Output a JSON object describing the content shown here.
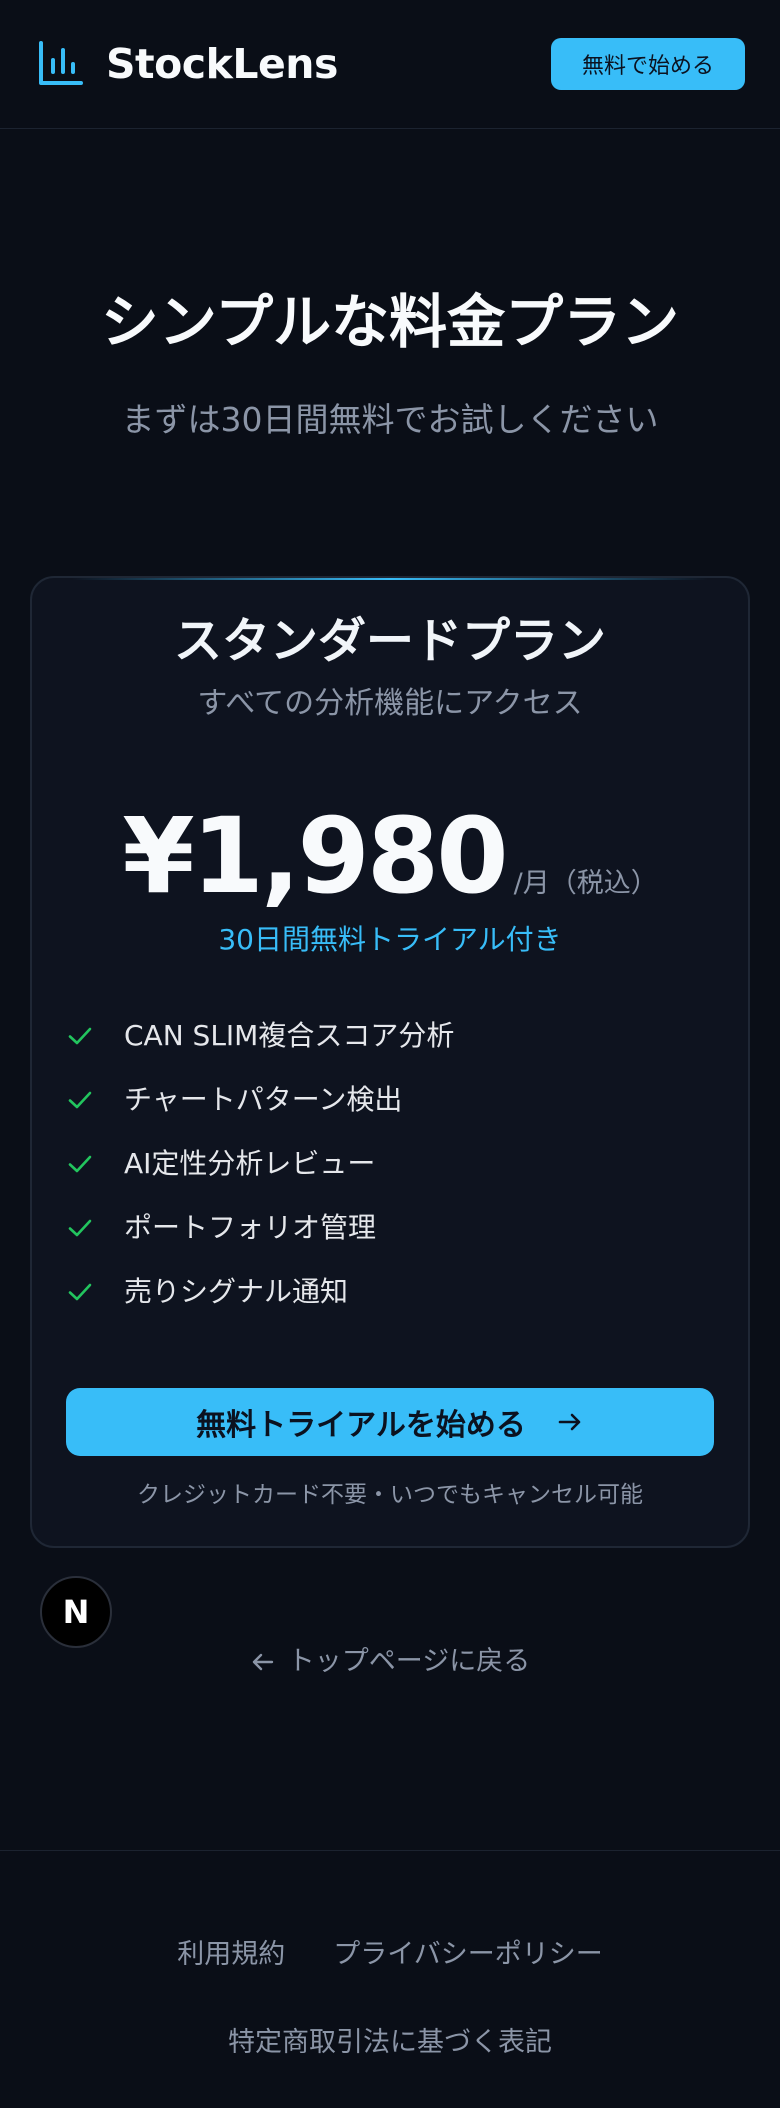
{
  "header": {
    "brand": "StockLens",
    "cta_label": "無料で始める"
  },
  "hero": {
    "title": "シンプルな料金プラン",
    "subtitle": "まずは30日間無料でお試しください"
  },
  "plan": {
    "name": "スタンダードプラン",
    "description": "すべての分析機能にアクセス",
    "price": "¥1,980",
    "price_unit": "/月（税込）",
    "trial_note": "30日間無料トライアル付き",
    "features": [
      "CAN SLIM複合スコア分析",
      "チャートパターン検出",
      "AI定性分析レビュー",
      "ポートフォリオ管理",
      "売りシグナル通知"
    ],
    "cta_label": "無料トライアルを始める",
    "note": "クレジットカード不要・いつでもキャンセル可能"
  },
  "badge": {
    "letter": "N"
  },
  "back_link": {
    "label": "トップページに戻る"
  },
  "footer": {
    "terms": "利用規約",
    "privacy": "プライバシーポリシー",
    "commerce": "特定商取引法に基づく表記"
  },
  "colors": {
    "background": "#0a0e17",
    "accent": "#38bdf8",
    "check": "#22c55e",
    "muted_text": "#8b95a7"
  },
  "icons": {
    "logo": "bar-chart-icon",
    "feature": "check-icon",
    "cta": "arrow-right-icon",
    "back": "arrow-left-icon"
  }
}
